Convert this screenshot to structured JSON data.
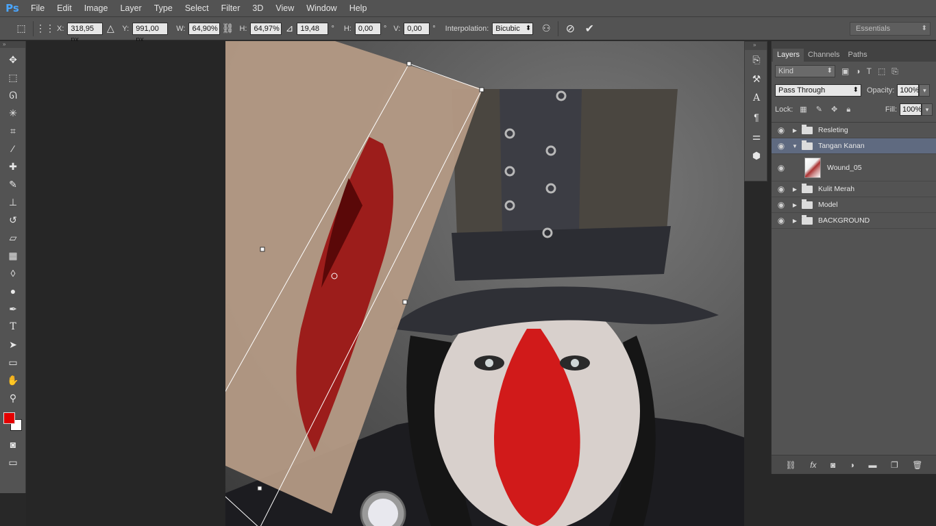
{
  "app": {
    "logo": "Ps"
  },
  "menu": [
    "File",
    "Edit",
    "Image",
    "Layer",
    "Type",
    "Select",
    "Filter",
    "3D",
    "View",
    "Window",
    "Help"
  ],
  "options": {
    "x_label": "X:",
    "x_value": "318,95 px",
    "y_label": "Y:",
    "y_value": "991,00 px",
    "w_label": "W:",
    "w_value": "64,90%",
    "h_label": "H:",
    "h_value": "64,97%",
    "angle_value": "19,48",
    "angle_unit": "°",
    "hskew_label": "H:",
    "hskew_value": "0,00",
    "vskew_label": "V:",
    "vskew_value": "0,00",
    "interp_label": "Interpolation:",
    "interp_value": "Bicubic",
    "workspace": "Essentials"
  },
  "layers_panel": {
    "tabs": [
      "Layers",
      "Channels",
      "Paths"
    ],
    "kind": "Kind",
    "blend_mode": "Pass Through",
    "opacity_label": "Opacity:",
    "opacity_value": "100%",
    "lock_label": "Lock:",
    "fill_label": "Fill:",
    "fill_value": "100%",
    "layers": [
      {
        "name": "Resleting",
        "type": "group",
        "expanded": false
      },
      {
        "name": "Tangan Kanan",
        "type": "group",
        "expanded": true,
        "selected": true
      },
      {
        "name": "Wound_05",
        "type": "layer"
      },
      {
        "name": "Kulit Merah",
        "type": "group",
        "expanded": false
      },
      {
        "name": "Model",
        "type": "group",
        "expanded": false
      },
      {
        "name": "BACKGROUND",
        "type": "group",
        "expanded": false
      }
    ]
  },
  "colors": {
    "foreground": "#e40000",
    "background": "#ffffff",
    "accent": "#4aa6ff"
  }
}
